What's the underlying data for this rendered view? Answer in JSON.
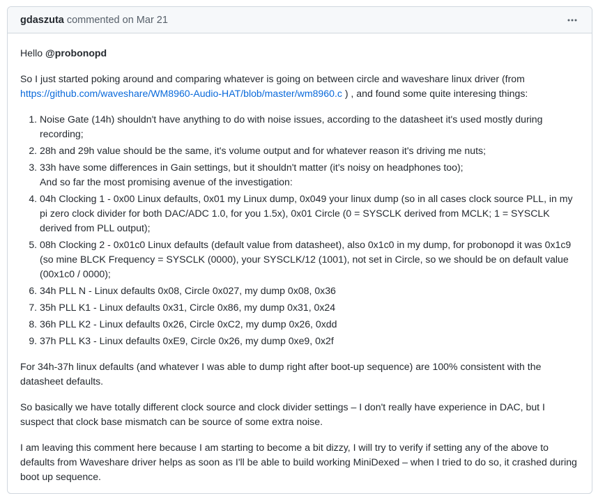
{
  "comment": {
    "author": "gdaszuta",
    "action": "commented on",
    "date": "Mar 21",
    "menu_icon": "kebab-horizontal-icon",
    "body": {
      "greeting_prefix": "Hello",
      "mention": "@probonopd",
      "intro_before_link": "So I just started poking around and comparing whatever is going on between circle and waveshare linux driver (from",
      "link_text": "https://github.com/waveshare/WM8960-Audio-HAT/blob/master/wm8960.c",
      "intro_after_link": ") , and found some quite interesing things:",
      "items": [
        {
          "text": "Noise Gate (14h) shouldn't have anything to do with noise issues, according to the datasheet it's used mostly during recording;"
        },
        {
          "text": "28h and 29h value should be the same, it's volume output and for whatever reason it's driving me nuts;"
        },
        {
          "text": "33h have some differences in Gain settings, but it shouldn't matter (it's noisy on headphones too);",
          "extra": "And so far the most promising avenue of the investigation:"
        },
        {
          "text": "04h Clocking 1 - 0x00 Linux defaults, 0x01 my Linux dump, 0x049 your linux dump (so in all cases clock source PLL, in my pi zero clock divider for both DAC/ADC 1.0, for you 1.5x), 0x01 Circle (0 = SYSCLK derived from MCLK; 1 = SYSCLK derived from PLL output);"
        },
        {
          "text": "08h Clocking 2 - 0x01c0 Linux defaults (default value from datasheet), also 0x1c0 in my dump, for probonopd it was 0x1c9 (so mine BLCK Frequency = SYSCLK (0000), your SYSCLK/12 (1001), not set in Circle, so we should be on default value (00x1c0 / 0000);"
        },
        {
          "text": "34h PLL N - Linux defaults 0x08, Circle 0x027, my dump 0x08, 0x36"
        },
        {
          "text": "35h PLL K1 - Linux defaults 0x31, Circle 0x86, my dump 0x31, 0x24"
        },
        {
          "text": "36h PLL K2 - Linux defaults 0x26, Circle 0xC2, my dump 0x26, 0xdd"
        },
        {
          "text": "37h PLL K3 - Linux defaults 0xE9, Circle 0x26, my dump 0xe9, 0x2f"
        }
      ],
      "para_defaults": "For 34h-37h linux defaults (and whatever I was able to dump right after boot-up sequence) are 100% consistent with the datasheet defaults.",
      "para_clock": "So basically we have totally different clock source and clock divider settings – I don't really have experience in DAC, but I suspect that clock base mismatch can be source of some extra noise.",
      "para_leaving": "I am leaving this comment here because I am starting to become a bit dizzy, I will try to verify if setting any of the above to defaults from Waveshare driver helps as soon as I'll be able to build working MiniDexed – when I tried to do so, it crashed during boot up sequence."
    }
  }
}
